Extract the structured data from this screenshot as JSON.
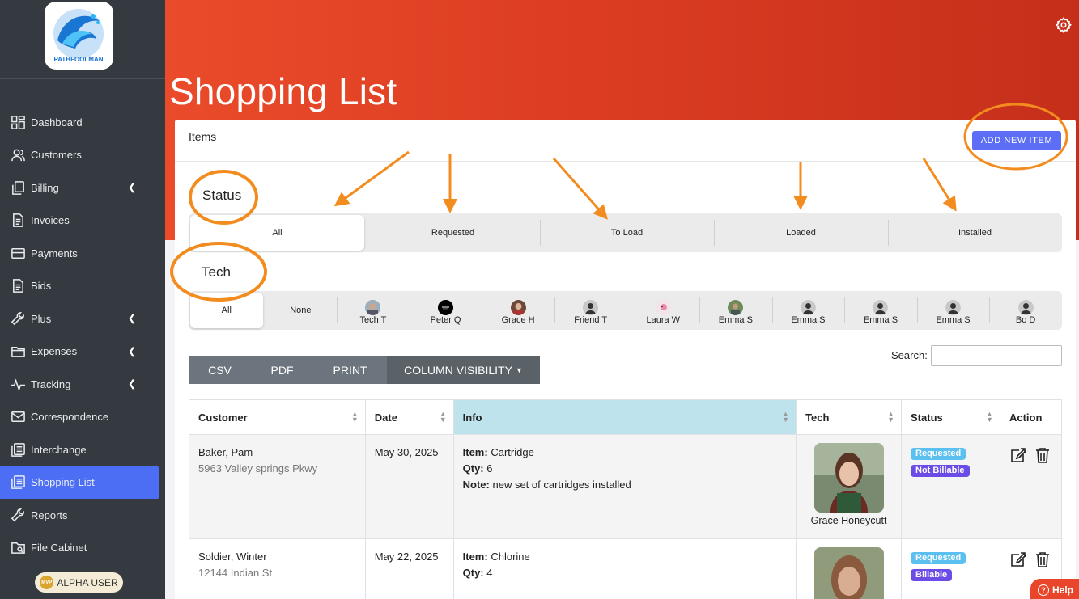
{
  "app": {
    "logo_text": "PATHFOOLMAN",
    "alpha_badge": "ALPHA USER",
    "alpha_badge_icon": "mvp-icon"
  },
  "sidebar": {
    "items": [
      {
        "label": "Dashboard",
        "icon": "dashboard-icon",
        "submenu": false
      },
      {
        "label": "Customers",
        "icon": "users-icon",
        "submenu": false
      },
      {
        "label": "Billing",
        "icon": "documents-icon",
        "submenu": true
      },
      {
        "label": "Invoices",
        "icon": "document-icon",
        "submenu": false
      },
      {
        "label": "Payments",
        "icon": "envelope-icon",
        "submenu": false
      },
      {
        "label": "Bids",
        "icon": "document-icon",
        "submenu": false
      },
      {
        "label": "Plus",
        "icon": "wrench-icon",
        "submenu": true
      },
      {
        "label": "Expenses",
        "icon": "folder-icon",
        "submenu": true
      },
      {
        "label": "Tracking",
        "icon": "pulse-icon",
        "submenu": true
      },
      {
        "label": "Correspondence",
        "icon": "mail-icon",
        "submenu": false
      },
      {
        "label": "Interchange",
        "icon": "list-icon",
        "submenu": false
      },
      {
        "label": "Shopping List",
        "icon": "list-icon",
        "submenu": false,
        "active": true
      },
      {
        "label": "Reports",
        "icon": "wrench-icon",
        "submenu": false
      },
      {
        "label": "File Cabinet",
        "icon": "folder-search-icon",
        "submenu": false
      }
    ]
  },
  "header": {
    "title": "Shopping List",
    "settings_icon": "gear-icon"
  },
  "card": {
    "title": "Items",
    "add_button": "ADD NEW ITEM"
  },
  "status_filter": {
    "label": "Status",
    "options": [
      "All",
      "Requested",
      "To Load",
      "Loaded",
      "Installed"
    ],
    "selected": "All"
  },
  "tech_filter": {
    "label": "Tech",
    "options": [
      {
        "name": "All"
      },
      {
        "name": "None"
      },
      {
        "name": "Tech T",
        "avatar": "photo"
      },
      {
        "name": "Peter Q",
        "avatar": "logo"
      },
      {
        "name": "Grace H",
        "avatar": "photo"
      },
      {
        "name": "Friend T",
        "avatar": "default"
      },
      {
        "name": "Laura W",
        "avatar": "photo"
      },
      {
        "name": "Emma S",
        "avatar": "photo"
      },
      {
        "name": "Emma S",
        "avatar": "default"
      },
      {
        "name": "Emma S",
        "avatar": "default"
      },
      {
        "name": "Emma S",
        "avatar": "default"
      },
      {
        "name": "Bo D",
        "avatar": "default"
      }
    ],
    "selected": "All"
  },
  "toolbar": {
    "csv": "CSV",
    "pdf": "PDF",
    "print": "PRINT",
    "column_visibility": "COLUMN VISIBILITY"
  },
  "search": {
    "label": "Search:",
    "value": ""
  },
  "table": {
    "columns": [
      "Customer",
      "Date",
      "Info",
      "Tech",
      "Status",
      "Action"
    ],
    "rows": [
      {
        "customer": "Baker, Pam",
        "address": "5963 Valley springs Pkwy",
        "date": "May 30, 2025",
        "item_label": "Item:",
        "item": "Cartridge",
        "qty_label": "Qty:",
        "qty": "6",
        "note_label": "Note:",
        "note": "new set of cartridges installed",
        "tech": "Grace Honeycutt",
        "status": "Requested",
        "billing": "Not Billable"
      },
      {
        "customer": "Soldier, Winter",
        "address": "12144 Indian St",
        "date": "May 22, 2025",
        "item_label": "Item:",
        "item": "Chlorine",
        "qty_label": "Qty:",
        "qty": "4",
        "tech": "",
        "status": "Requested",
        "billing": "Billable"
      }
    ]
  },
  "help": {
    "label": "Help"
  },
  "colors": {
    "sidebar_bg": "#343a40",
    "active_nav": "#4c6ef5",
    "header_red": "#dc3d22",
    "add_button": "#5b6ef5",
    "annotation_orange": "#f28c1e",
    "badge_requested": "#5bc0f0",
    "badge_billable": "#6b4ce6",
    "info_header": "#bfe3ec"
  }
}
